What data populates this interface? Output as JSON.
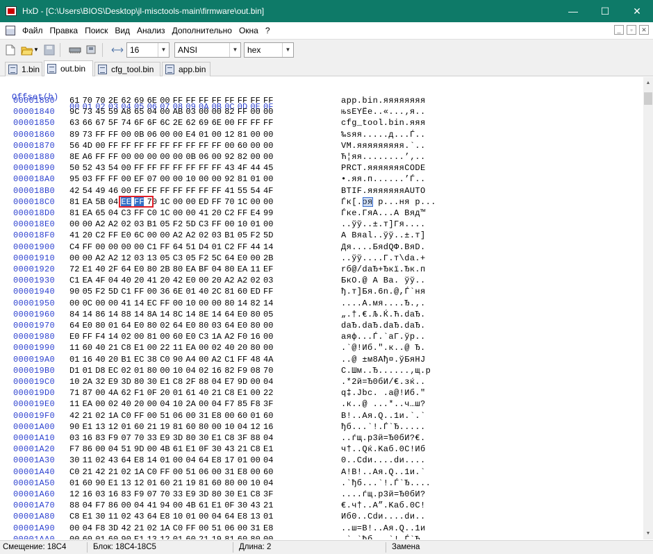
{
  "window": {
    "title": "HxD - [C:\\Users\\BIOS\\Desktop\\jl-misctools-main\\firmware\\out.bin]",
    "minimize_glyph": "—",
    "maximize_glyph": "☐",
    "close_glyph": "✕"
  },
  "menu": {
    "items": [
      "Файл",
      "Правка",
      "Поиск",
      "Вид",
      "Анализ",
      "Дополнительно",
      "Окна",
      "?"
    ]
  },
  "toolbar": {
    "bytes_per_row": "16",
    "charset": "ANSI",
    "offset_base": "hex"
  },
  "tabs": [
    {
      "label": "1.bin",
      "active": false
    },
    {
      "label": "out.bin",
      "active": true
    },
    {
      "label": "cfg_tool.bin",
      "active": false
    },
    {
      "label": "app.bin",
      "active": false
    }
  ],
  "hex": {
    "header_label": "Offset(h)",
    "columns": [
      "00",
      "01",
      "02",
      "03",
      "04",
      "05",
      "06",
      "07",
      "08",
      "09",
      "0A",
      "0B",
      "0C",
      "0D",
      "0E",
      "0F"
    ],
    "selected_offset": "000018C4",
    "rows": [
      {
        "offset": "00001830",
        "bytes": "61 70 70 2E 62 69 6E 00 FF FF FF FF FF FF FF FF",
        "ascii": "app.bin.яяяяяяяя"
      },
      {
        "offset": "00001840",
        "bytes": "9C 73 45 59 A8 65 04 00 AB 03 00 00 82 FF 00 00",
        "ascii": "њsEYЁe..«...‚я.."
      },
      {
        "offset": "00001850",
        "bytes": "63 66 67 5F 74 6F 6F 6C 2E 62 69 6E 00 FF FF FF",
        "ascii": "cfg_tool.bin.яяя"
      },
      {
        "offset": "00001860",
        "bytes": "89 73 FF FF 00 0B 06 00 00 E4 01 00 12 81 00 00",
        "ascii": "‰sяя.....д...Ѓ.."
      },
      {
        "offset": "00001870",
        "bytes": "56 4D 00 FF FF FF FF FF FF FF FF FF 00 60 00 00",
        "ascii": "VM.яяяяяяяяя.`.."
      },
      {
        "offset": "00001880",
        "bytes": "8E A6 FF FF 00 00 00 00 00 0B 06 00 92 82 00 00",
        "ascii": "Ћ¦яя........’‚.."
      },
      {
        "offset": "00001890",
        "bytes": "50 52 43 54 00 FF FF FF FF FF FF FF 43 4F 44 45",
        "ascii": "PRCT.яяяяяяяCODE"
      },
      {
        "offset": "000018A0",
        "bytes": "95 03 FF FF 00 EF 07 00 00 10 00 00 92 81 01 00",
        "ascii": "•.яя.п......’Ѓ.."
      },
      {
        "offset": "000018B0",
        "bytes": "42 54 49 46 00 FF FF FF FF FF FF FF 41 55 54 4F",
        "ascii": "BTIF.яяяяяяяAUTO"
      },
      {
        "offset": "000018C0",
        "bytes": "81 EA 5B 04 EE FF 70 1C 00 00 ED FF 70 1C 00 00",
        "ascii": "Ѓк[.оя p...ня p..."
      },
      {
        "offset": "000018D0",
        "bytes": "81 EA 65 04 C3 FF C0 1C 00 00 41 20 C2 FF E4 99",
        "ascii": "Ѓке.ГяА...А Вяд™"
      },
      {
        "offset": "000018E0",
        "bytes": "00 00 A2 A2 02 03 B1 05 F2 5D C3 FF 00 10 01 00",
        "ascii": "..ўў..±.т]Гя...."
      },
      {
        "offset": "000018F0",
        "bytes": "41 20 C2 FF E0 6C 00 00 A2 A2 02 03 B1 05 F2 5D",
        "ascii": "A Вяаl..ўў..±.т]"
      },
      {
        "offset": "00001900",
        "bytes": "C4 FF 00 00 00 00 C1 FF 64 51 D4 01 C2 FF 44 14",
        "ascii": "Дя....БяdQФ.ВяD."
      },
      {
        "offset": "00001910",
        "bytes": "00 00 A2 A2 12 03 13 05 C3 05 F2 5C 64 E0 00 2B",
        "ascii": "..ўў....Г.т\\da.+"
      },
      {
        "offset": "00001920",
        "bytes": "72 E1 40 2F 64 E0 80 2B 80 EA BF 04 80 EA 11 EF",
        "ascii": "rб@/daЂ+Ђкї.Ђк.п"
      },
      {
        "offset": "00001930",
        "bytes": "C1 EA 4F 04 40 20 41 20 42 E0 00 20 A2 A2 02 03",
        "ascii": "БкО.@ A Ва. ўў.."
      },
      {
        "offset": "00001940",
        "bytes": "90 05 F2 5D C1 FF 00 36 6E 01 40 2C 81 60 ED FF",
        "ascii": "ђ.т]Бя.6n.@,Ѓ`ня"
      },
      {
        "offset": "00001950",
        "bytes": "00 0C 00 00 41 14 EC FF 00 10 00 00 80 14 82 14",
        "ascii": "....A.мя....Ђ.‚."
      },
      {
        "offset": "00001960",
        "bytes": "84 14 86 14 88 14 8A 14 8C 14 8E 14 64 E0 80 05",
        "ascii": "„.†.€.Љ.Ќ.Ћ.daЂ."
      },
      {
        "offset": "00001970",
        "bytes": "64 E0 80 01 64 E0 80 02 64 E0 80 03 64 E0 80 00",
        "ascii": "daЂ.daЂ.daЂ.daЂ."
      },
      {
        "offset": "00001980",
        "bytes": "E0 FF F4 14 02 00 81 00 60 E0 C3 1A A2 F0 16 00",
        "ascii": "аяф...Ѓ.`аГ.ўр.."
      },
      {
        "offset": "00001990",
        "bytes": "11 60 40 21 C8 E1 00 22 11 EA 00 02 40 20 80 00",
        "ascii": ".`@!Иб.\".к..@ Ђ."
      },
      {
        "offset": "000019A0",
        "bytes": "01 16 40 20 B1 EC 38 C0 90 A4 00 A2 C1 FF 48 4A",
        "ascii": "..@ ±м8Ађ¤.ўБяHJ"
      },
      {
        "offset": "000019B0",
        "bytes": "D1 01 D8 EC 02 01 80 00 10 04 02 16 82 F9 08 70",
        "ascii": "С.Шм..Ђ......‚щ.p"
      },
      {
        "offset": "000019C0",
        "bytes": "10 2A 32 E9 3D 80 30 E1 C8 2F 88 04 E7 9D 00 04",
        "ascii": ".*2й=Ђ0бИ/€.зќ.."
      },
      {
        "offset": "000019D0",
        "bytes": "71 87 00 4A 62 F1 0F 20 01 61 40 21 C8 E1 00 22",
        "ascii": "q‡.Jbс. .a@!Иб.\""
      },
      {
        "offset": "000019E0",
        "bytes": "11 EA 00 02 40 20 00 04 10 2A 00 04 F7 85 F8 3F",
        "ascii": ".к..@ ...*..ч…ш?"
      },
      {
        "offset": "000019F0",
        "bytes": "42 21 02 1A C0 FF 00 51 06 00 31 E8 00 60 01 60",
        "ascii": "B!..Ая.Q..1и.`.`"
      },
      {
        "offset": "00001A00",
        "bytes": "90 E1 13 12 01 60 21 19 81 60 80 00 10 04 12 16",
        "ascii": "ђб...`!.Ѓ`Ђ....."
      },
      {
        "offset": "00001A10",
        "bytes": "03 16 83 F9 07 70 33 E9 3D 80 30 E1 C8 3F 88 04",
        "ascii": "..ѓщ.p3й=Ђ0бИ?€."
      },
      {
        "offset": "00001A20",
        "bytes": "F7 86 00 04 51 9D 00 4B 61 E1 0F 30 43 21 C8 E1",
        "ascii": "ч†..Qќ.Kaб.0C!Иб"
      },
      {
        "offset": "00001A30",
        "bytes": "30 11 02 43 64 E8 14 01 00 04 64 E8 17 01 00 04",
        "ascii": "0..Cdи....dи...."
      },
      {
        "offset": "00001A40",
        "bytes": "C0 21 42 21 02 1A C0 FF 00 51 06 00 31 E8 00 60",
        "ascii": "А!B!..Ая.Q..1и.`"
      },
      {
        "offset": "00001A50",
        "bytes": "01 60 90 E1 13 12 01 60 21 19 81 60 80 00 10 04",
        "ascii": ".`ђб...`!.Ѓ`Ђ...."
      },
      {
        "offset": "00001A60",
        "bytes": "12 16 03 16 83 F9 07 70 33 E9 3D 80 30 E1 C8 3F",
        "ascii": "....ѓщ.p3й=Ђ0бИ?"
      },
      {
        "offset": "00001A70",
        "bytes": "88 04 F7 86 00 04 41 94 00 4B 61 E1 0F 30 43 21",
        "ascii": "€.ч†..A”.Kaб.0C!"
      },
      {
        "offset": "00001A80",
        "bytes": "C8 E1 30 11 02 43 64 E8 10 01 00 04 64 E8 13 01",
        "ascii": "Иб0..Cdи....dи.."
      },
      {
        "offset": "00001A90",
        "bytes": "00 04 F8 3D 42 21 02 1A C0 FF 00 51 06 00 31 E8",
        "ascii": "..ш=B!..Ая.Q..1и"
      },
      {
        "offset": "00001AA0",
        "bytes": "00 60 01 60 90 E1 13 12 01 60 21 19 81 60 80 00",
        "ascii": ".`.`ђб...`!.Ѓ`Ђ."
      }
    ]
  },
  "status": {
    "offset_label": "Смещение: 18C4",
    "block_label": "Блок: 18C4-18C5",
    "length_label": "Длина: 2",
    "mode_label": "Замена"
  }
}
